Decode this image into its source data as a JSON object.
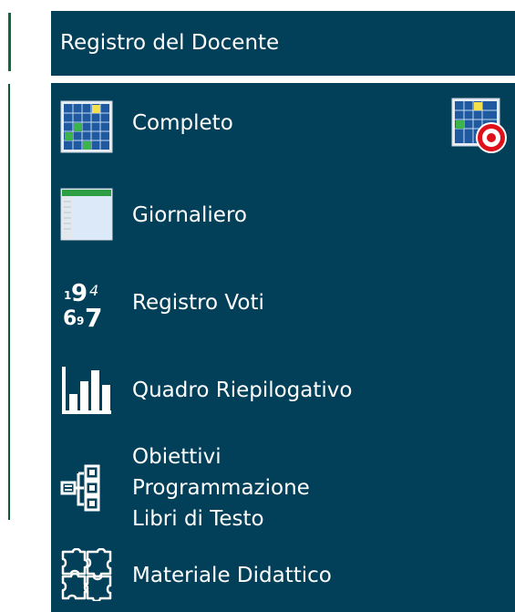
{
  "header": {
    "title": "Registro del Docente"
  },
  "menu": {
    "items": [
      {
        "label": "Completo",
        "icon": "calendar-grid-icon"
      },
      {
        "label": "Giornaliero",
        "icon": "daily-sheet-icon"
      },
      {
        "label": "Registro Voti",
        "icon": "grades-numbers-icon"
      },
      {
        "label": "Quadro Riepilogativo",
        "icon": "bar-chart-icon"
      },
      {
        "label": "Obiettivi\nProgrammazione\nLibri di Testo",
        "icon": "hierarchy-tree-icon"
      },
      {
        "label": "Materiale Didattico",
        "icon": "puzzle-pieces-icon"
      }
    ],
    "extra_icon": "calendar-target-icon"
  },
  "colors": {
    "panel_bg": "#024059",
    "accent_green": "#0c6a3c",
    "text": "#ffffff"
  }
}
